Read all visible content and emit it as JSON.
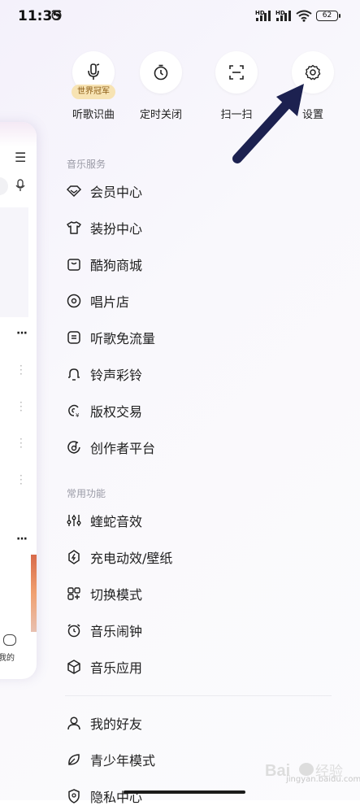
{
  "status_bar": {
    "time": "11:35",
    "battery": "62",
    "hd1": "HD",
    "hd2": "HD"
  },
  "quick_actions": [
    {
      "label": "听歌识曲",
      "badge": "世界冠军",
      "icon": "mic-music-icon"
    },
    {
      "label": "定时关闭",
      "icon": "timer-icon"
    },
    {
      "label": "扫一扫",
      "icon": "scan-icon"
    },
    {
      "label": "设置",
      "icon": "gear-icon"
    }
  ],
  "sections": {
    "music_services": "音乐服务",
    "common_functions": "常用功能"
  },
  "music_services": [
    {
      "label": "会员中心",
      "icon": "diamond-icon"
    },
    {
      "label": "装扮中心",
      "icon": "tshirt-icon"
    },
    {
      "label": "酷狗商城",
      "icon": "shopping-bag-icon"
    },
    {
      "label": "唱片店",
      "icon": "vinyl-disc-icon"
    },
    {
      "label": "听歌免流量",
      "icon": "data-free-icon"
    },
    {
      "label": "铃声彩铃",
      "icon": "bell-icon"
    },
    {
      "label": "版权交易",
      "icon": "copyright-icon"
    },
    {
      "label": "创作者平台",
      "icon": "creator-icon"
    }
  ],
  "common_functions": [
    {
      "label": "蝰蛇音效",
      "icon": "equalizer-icon"
    },
    {
      "label": "充电动效/壁纸",
      "icon": "charging-icon"
    },
    {
      "label": "切换模式",
      "icon": "switch-mode-icon"
    },
    {
      "label": "音乐闹钟",
      "icon": "alarm-clock-icon"
    },
    {
      "label": "音乐应用",
      "icon": "cube-icon"
    }
  ],
  "social": [
    {
      "label": "我的好友",
      "icon": "person-icon"
    },
    {
      "label": "青少年模式",
      "icon": "leaf-icon"
    },
    {
      "label": "隐私中心",
      "icon": "privacy-icon"
    }
  ],
  "left_card": {
    "mine_label": "我的"
  },
  "watermark": {
    "text": "jingyan.baidu.com",
    "brand": "Bai 经验"
  },
  "colors": {
    "accent_badge_bg": "#f7e3b3",
    "badge_text": "#8a5a12",
    "arrow": "#1c2150"
  }
}
